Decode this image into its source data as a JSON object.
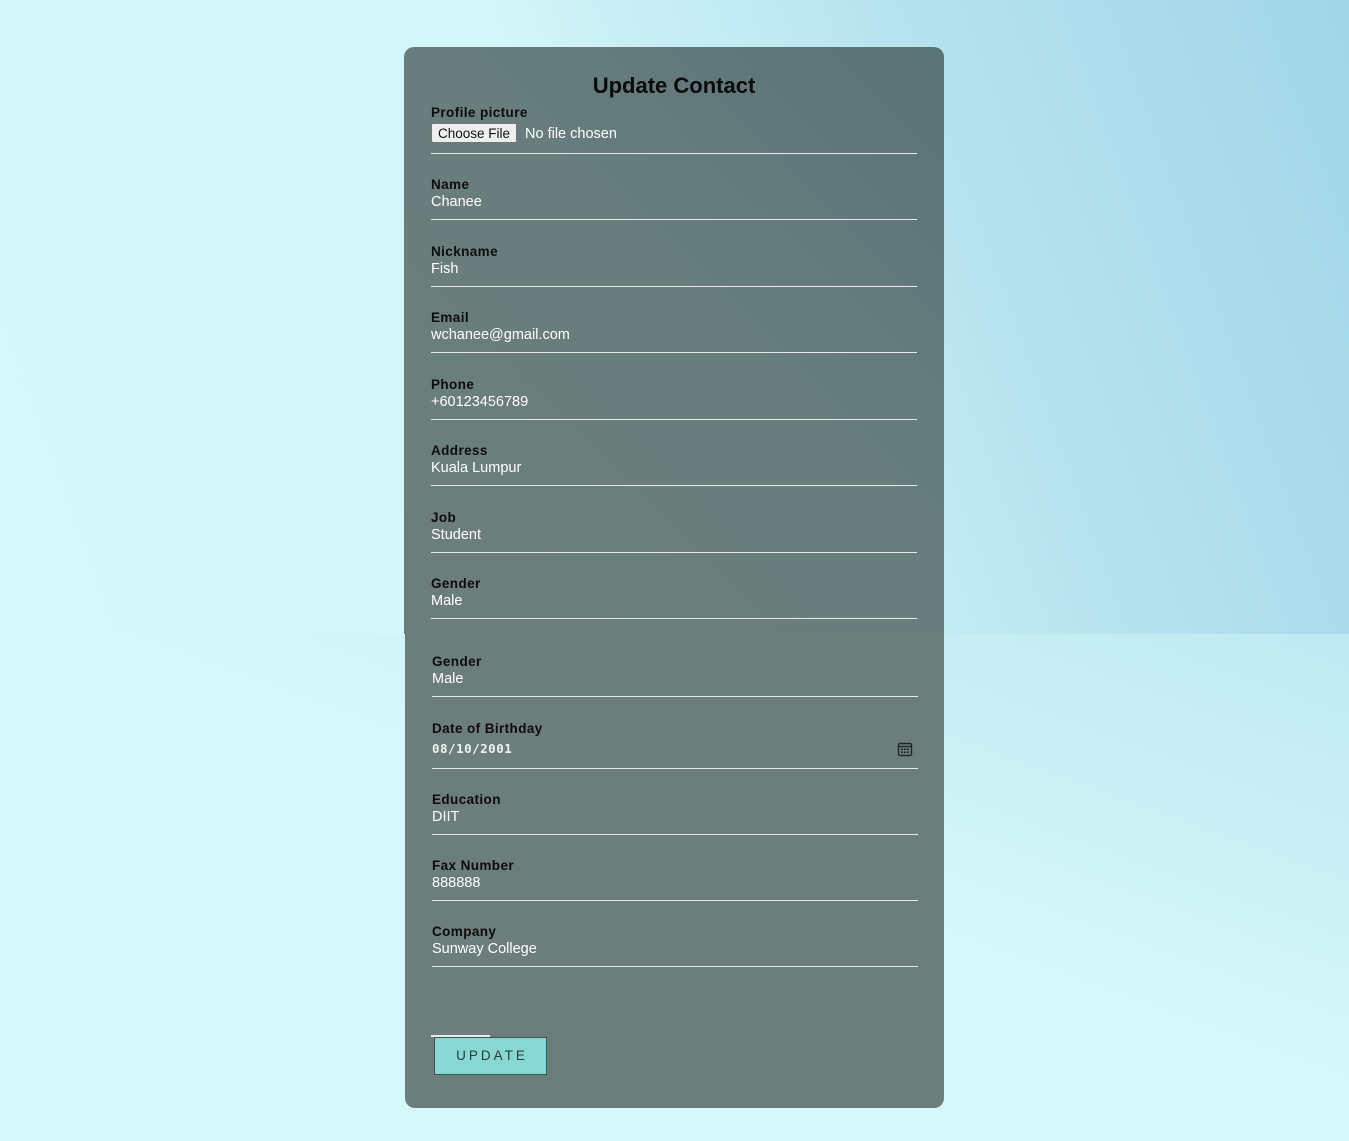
{
  "form": {
    "title": "Update Contact",
    "profile_picture": {
      "label": "Profile picture",
      "button_label": "Choose File",
      "status": "No file chosen"
    },
    "fields": {
      "name": {
        "label": "Name",
        "value": "Chanee"
      },
      "nickname": {
        "label": "Nickname",
        "value": "Fish"
      },
      "email": {
        "label": "Email",
        "value": "wchanee@gmail.com"
      },
      "phone": {
        "label": "Phone",
        "value": "+60123456789"
      },
      "address": {
        "label": "Address",
        "value": "Kuala Lumpur"
      },
      "job": {
        "label": "Job",
        "value": "Student"
      },
      "gender": {
        "label": "Gender",
        "value": "Male"
      },
      "gender_repeat": {
        "label": "Gender",
        "value": "Male"
      },
      "dob": {
        "label": "Date of Birthday",
        "value": "08/10/2001"
      },
      "education": {
        "label": "Education",
        "value": "DIIT"
      },
      "fax": {
        "label": "Fax Number",
        "value": "888888"
      },
      "company": {
        "label": "Company",
        "value": "Sunway College"
      }
    },
    "submit_label": "UPDATE"
  },
  "icons": {
    "date_picker": "calendar-icon"
  },
  "colors": {
    "card": "#6c7e7b",
    "button": "#87d8d3",
    "background": "#d5f8fa"
  }
}
